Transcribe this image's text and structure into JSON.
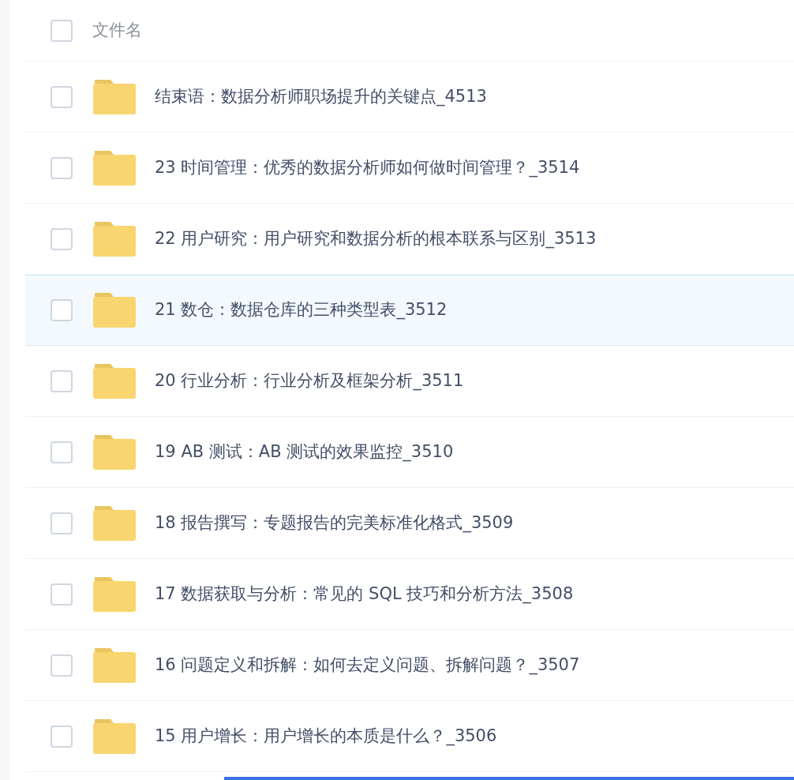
{
  "header": {
    "checked": false,
    "label": "文件名"
  },
  "rows": [
    {
      "name": "结束语：数据分析师职场提升的关键点_4513",
      "checked": false,
      "selected": false
    },
    {
      "name": "23 时间管理：优秀的数据分析师如何做时间管理？_3514",
      "checked": false,
      "selected": false
    },
    {
      "name": "22 用户研究：用户研究和数据分析的根本联系与区别_3513",
      "checked": false,
      "selected": false
    },
    {
      "name": "21 数仓：数据仓库的三种类型表_3512",
      "checked": false,
      "selected": true
    },
    {
      "name": "20 行业分析：行业分析及框架分析_3511",
      "checked": false,
      "selected": false
    },
    {
      "name": "19 AB 测试：AB 测试的效果监控_3510",
      "checked": false,
      "selected": false
    },
    {
      "name": "18 报告撰写：专题报告的完美标准化格式_3509",
      "checked": false,
      "selected": false
    },
    {
      "name": "17 数据获取与分析：常见的 SQL 技巧和分析方法_3508",
      "checked": false,
      "selected": false
    },
    {
      "name": "16 问题定义和拆解：如何去定义问题、拆解问题？_3507",
      "checked": false,
      "selected": false
    },
    {
      "name": "15 用户增长：用户增长的本质是什么？_3506",
      "checked": false,
      "selected": false
    }
  ]
}
